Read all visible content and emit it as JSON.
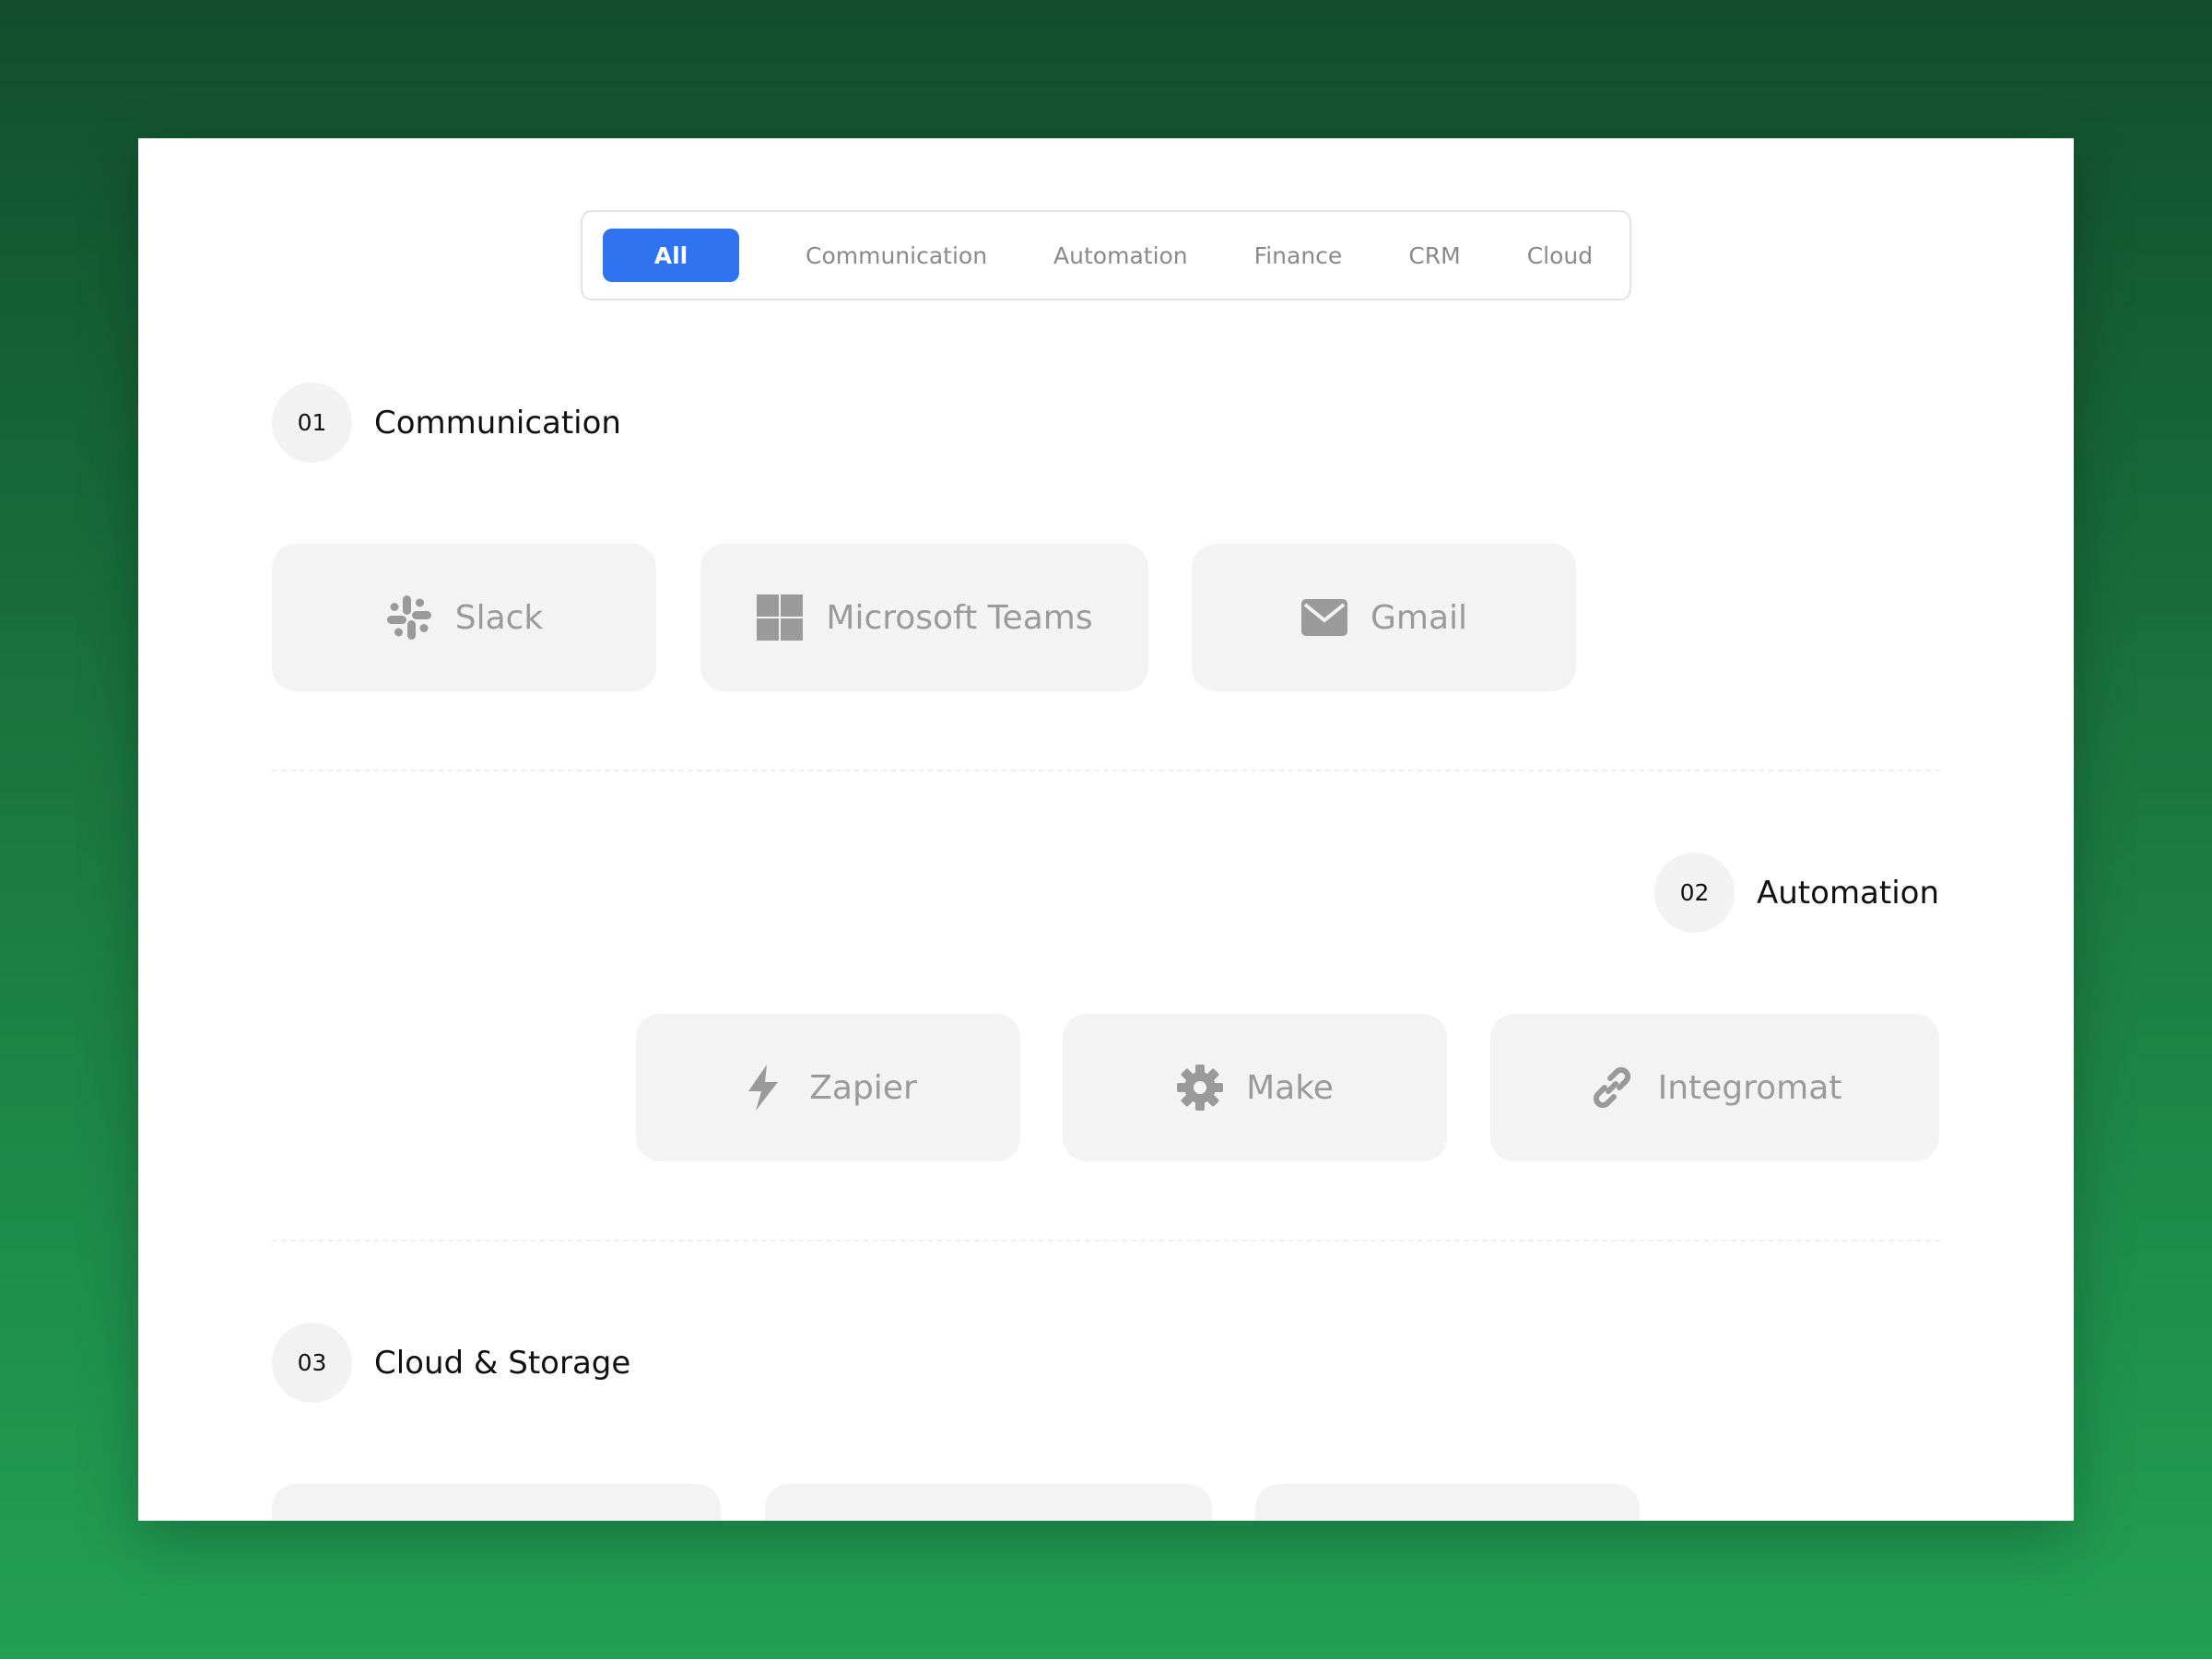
{
  "filters": {
    "tabs": [
      {
        "label": "All",
        "active": true
      },
      {
        "label": "Communication",
        "active": false
      },
      {
        "label": "Automation",
        "active": false
      },
      {
        "label": "Finance",
        "active": false
      },
      {
        "label": "CRM",
        "active": false
      },
      {
        "label": "Cloud",
        "active": false
      }
    ]
  },
  "sections": [
    {
      "number": "01",
      "title": "Communication",
      "items": [
        {
          "label": "Slack",
          "icon": "slack-icon"
        },
        {
          "label": "Microsoft Teams",
          "icon": "windows-grid-icon"
        },
        {
          "label": "Gmail",
          "icon": "envelope-icon"
        }
      ]
    },
    {
      "number": "02",
      "title": "Automation",
      "items": [
        {
          "label": "Zapier",
          "icon": "lightning-icon"
        },
        {
          "label": "Make",
          "icon": "gear-icon"
        },
        {
          "label": "Integromat",
          "icon": "link-icon"
        }
      ]
    },
    {
      "number": "03",
      "title": "Cloud & Storage",
      "items": []
    }
  ],
  "colors": {
    "accent": "#2f73f0",
    "card_bg": "#f3f3f3",
    "muted_text": "#9a9a9a",
    "background_top": "#124e2d",
    "background_bottom": "#22a055"
  }
}
